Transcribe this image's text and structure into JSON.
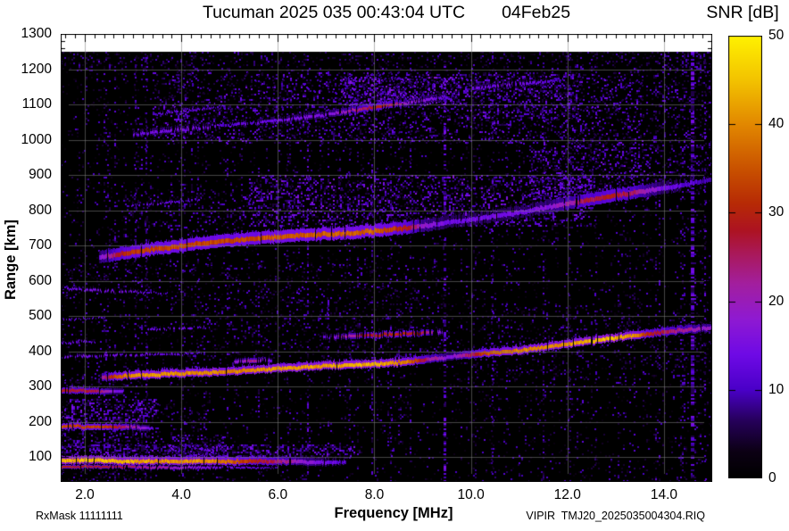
{
  "header": {
    "title": "Tucuman 2025 035 00:43:04 UTC",
    "date": "04Feb25"
  },
  "footer": {
    "left": "RxMask 11111111",
    "right": "VIPIR  TMJ20_2025035004304.RIQ"
  },
  "colorbar": {
    "title": "SNR [dB]",
    "min": 0,
    "max": 50,
    "tick_values": [
      0,
      10,
      20,
      30,
      40,
      50
    ],
    "tick_labels": [
      "0",
      "10",
      "20",
      "30",
      "40",
      "50"
    ]
  },
  "axes": {
    "xlabel": "Frequency [MHz]",
    "ylabel": "Range [km]",
    "x_tick_values": [
      2,
      4,
      6,
      8,
      10,
      12,
      14
    ],
    "x_tick_labels": [
      "2.0",
      "4.0",
      "6.0",
      "8.0",
      "10.0",
      "12.0",
      "14.0"
    ],
    "y_tick_values": [
      100,
      200,
      300,
      400,
      500,
      600,
      700,
      800,
      900,
      1000,
      1100,
      1200,
      1300
    ],
    "y_tick_labels": [
      "100",
      "200",
      "300",
      "400",
      "500",
      "600",
      "700",
      "800",
      "900",
      "1000",
      "1100",
      "1200",
      "1300"
    ]
  },
  "chart_data": {
    "type": "heatmap",
    "title": "Tucuman 2025 035 00:43:04 UTC",
    "date": "04Feb25",
    "station": "Tucuman",
    "xlabel": "Frequency [MHz]",
    "ylabel": "Range [km]",
    "zlabel": "SNR [dB]",
    "x_range_mhz": [
      1.5,
      15.0
    ],
    "y_range_km": [
      30,
      1300
    ],
    "z_range_db": [
      0,
      50
    ],
    "x_major_tick_step": 2.0,
    "x_minor_tick_step": 0.2,
    "y_major_tick_step": 100,
    "y_minor_tick_step": 20,
    "grid": true,
    "grid_color": "#808080",
    "background_color": "#000000",
    "no_data_color": "#ffffff",
    "data_max_range_km": 1250,
    "colormap_stops": [
      {
        "t": 0.0,
        "c": "#000000"
      },
      {
        "t": 0.06,
        "c": "#0c0014"
      },
      {
        "t": 0.13,
        "c": "#26005a"
      },
      {
        "t": 0.2,
        "c": "#4a00c8"
      },
      {
        "t": 0.28,
        "c": "#6f0ae6"
      },
      {
        "t": 0.36,
        "c": "#8f1ad2"
      },
      {
        "t": 0.44,
        "c": "#a31f9e"
      },
      {
        "t": 0.5,
        "c": "#a91a62"
      },
      {
        "t": 0.56,
        "c": "#ad1322"
      },
      {
        "t": 0.62,
        "c": "#b72a06"
      },
      {
        "t": 0.7,
        "c": "#c95200"
      },
      {
        "t": 0.8,
        "c": "#e28800"
      },
      {
        "t": 0.9,
        "c": "#f3c300"
      },
      {
        "t": 1.0,
        "c": "#fff200"
      }
    ],
    "traces": [
      {
        "name": "es-layer-1st-hop",
        "points": [
          [
            1.5,
            90
          ],
          [
            3.5,
            89
          ],
          [
            5.5,
            88
          ],
          [
            7.4,
            86
          ]
        ],
        "db": [
          [
            1.5,
            43
          ],
          [
            2.5,
            44
          ],
          [
            3.5,
            41
          ],
          [
            4.6,
            40
          ],
          [
            5.2,
            34
          ],
          [
            5.8,
            26
          ],
          [
            6.6,
            17
          ],
          [
            7.4,
            11
          ]
        ],
        "th": 4,
        "halo": 5,
        "gap": 0.02
      },
      {
        "name": "es-layer-1st-hop-lower",
        "points": [
          [
            1.5,
            73
          ],
          [
            4.0,
            71
          ],
          [
            6.0,
            70
          ]
        ],
        "db": [
          [
            1.5,
            30
          ],
          [
            2.5,
            27
          ],
          [
            3.5,
            22
          ],
          [
            4.8,
            14
          ],
          [
            6.0,
            8
          ]
        ],
        "th": 2,
        "halo": 2,
        "gap": 0.1
      },
      {
        "name": "es-layer-2nd-hop",
        "points": [
          [
            1.5,
            189
          ],
          [
            3.4,
            185
          ]
        ],
        "db": [
          [
            1.5,
            34
          ],
          [
            2.4,
            33
          ],
          [
            2.9,
            23
          ],
          [
            3.4,
            12
          ]
        ],
        "th": 3,
        "halo": 4,
        "gap": 0.05
      },
      {
        "name": "es-layer-3rd-hop",
        "points": [
          [
            1.5,
            291
          ],
          [
            2.8,
            287
          ]
        ],
        "db": [
          [
            1.5,
            30
          ],
          [
            2.2,
            27
          ],
          [
            2.8,
            12
          ]
        ],
        "th": 3,
        "halo": 4,
        "gap": 0.06
      },
      {
        "name": "f-layer-1st-hop",
        "points": [
          [
            2.35,
            326
          ],
          [
            3,
            332
          ],
          [
            4,
            337
          ],
          [
            4.6,
            340
          ],
          [
            5.5,
            347
          ],
          [
            6.5,
            355
          ],
          [
            7.5,
            361
          ],
          [
            8.35,
            366
          ],
          [
            9,
            375
          ],
          [
            9.6,
            385
          ],
          [
            10.1,
            392
          ],
          [
            10.8,
            400
          ],
          [
            11.3,
            407
          ],
          [
            12.2,
            425
          ],
          [
            13,
            438
          ],
          [
            13.4,
            445
          ],
          [
            14.2,
            458
          ],
          [
            15,
            467
          ]
        ],
        "db": [
          [
            2.35,
            20
          ],
          [
            2.6,
            34
          ],
          [
            3,
            41
          ],
          [
            4,
            40
          ],
          [
            5,
            39
          ],
          [
            6,
            41
          ],
          [
            7,
            42
          ],
          [
            8,
            43
          ],
          [
            8.7,
            38
          ],
          [
            9.1,
            23
          ],
          [
            9.6,
            16
          ],
          [
            10.1,
            29
          ],
          [
            10.5,
            37
          ],
          [
            11,
            39
          ],
          [
            12,
            41
          ],
          [
            12.9,
            45
          ],
          [
            13.4,
            40
          ],
          [
            13.7,
            29
          ],
          [
            14,
            26
          ],
          [
            14.4,
            22
          ],
          [
            15,
            18
          ]
        ],
        "th": 4,
        "halo": 5,
        "gap": 0.02
      },
      {
        "name": "f-layer-upper-branch",
        "points": [
          [
            6.9,
            441
          ],
          [
            8.0,
            448
          ],
          [
            9.4,
            456
          ]
        ],
        "db": [
          [
            6.9,
            13
          ],
          [
            7.6,
            24
          ],
          [
            8.3,
            31
          ],
          [
            8.9,
            28
          ],
          [
            9.4,
            15
          ]
        ],
        "th": 3,
        "halo": 4,
        "gap": 0.3
      },
      {
        "name": "f-layer-faint-low",
        "points": [
          [
            1.5,
            385
          ],
          [
            3.0,
            390
          ],
          [
            4.4,
            394
          ]
        ],
        "db": [
          [
            1.5,
            13
          ],
          [
            2.5,
            15
          ],
          [
            3.5,
            13
          ],
          [
            4.4,
            9
          ]
        ],
        "th": 2,
        "halo": 2,
        "gap": 0.4
      },
      {
        "name": "faint-dash-a",
        "points": [
          [
            1.5,
            424
          ],
          [
            2.2,
            428
          ]
        ],
        "db": [
          [
            1.5,
            13
          ],
          [
            2.2,
            11
          ]
        ],
        "th": 2,
        "halo": 2,
        "gap": 0.35
      },
      {
        "name": "faint-dash-b",
        "points": [
          [
            5.1,
            372
          ],
          [
            5.9,
            377
          ]
        ],
        "db": [
          [
            5.1,
            18
          ],
          [
            5.5,
            23
          ],
          [
            5.9,
            13
          ]
        ],
        "th": 3,
        "halo": 3,
        "gap": 0.2
      },
      {
        "name": "faint-dash-c",
        "points": [
          [
            3.3,
            462
          ],
          [
            4.6,
            468
          ]
        ],
        "db": [
          [
            3.3,
            12
          ],
          [
            4.0,
            14
          ],
          [
            4.6,
            10
          ]
        ],
        "th": 2,
        "halo": 2,
        "gap": 0.4
      },
      {
        "name": "faint-dash-d",
        "points": [
          [
            1.6,
            578
          ],
          [
            2.6,
            570
          ],
          [
            3.7,
            564
          ]
        ],
        "db": [
          [
            1.6,
            12
          ],
          [
            2.2,
            16
          ],
          [
            3.0,
            14
          ],
          [
            3.7,
            9
          ]
        ],
        "th": 2,
        "halo": 2,
        "gap": 0.45
      },
      {
        "name": "faint-dash-e",
        "points": [
          [
            1.5,
            490
          ],
          [
            2.4,
            495
          ]
        ],
        "db": [
          [
            1.5,
            13
          ],
          [
            2.4,
            10
          ]
        ],
        "th": 2,
        "halo": 2,
        "gap": 0.4
      },
      {
        "name": "f-layer-2nd-hop",
        "points": [
          [
            2.3,
            668
          ],
          [
            3.5,
            692
          ],
          [
            5,
            716
          ],
          [
            6.5,
            730
          ],
          [
            7.6,
            737
          ],
          [
            8.6,
            750
          ],
          [
            9.2,
            760
          ],
          [
            10,
            775
          ],
          [
            11,
            795
          ],
          [
            12,
            820
          ],
          [
            13,
            843
          ],
          [
            13.6,
            856
          ],
          [
            14.2,
            868
          ],
          [
            15,
            888
          ]
        ],
        "db": [
          [
            2.3,
            16
          ],
          [
            2.8,
            30
          ],
          [
            3.5,
            34
          ],
          [
            5,
            33
          ],
          [
            6,
            35
          ],
          [
            7,
            36
          ],
          [
            8,
            36
          ],
          [
            8.6,
            30
          ],
          [
            9,
            18
          ],
          [
            9.6,
            13
          ],
          [
            10.5,
            15
          ],
          [
            11.3,
            14
          ],
          [
            11.9,
            20
          ],
          [
            12.4,
            26
          ],
          [
            12.9,
            28
          ],
          [
            13.4,
            24
          ],
          [
            14,
            14
          ],
          [
            14.6,
            11
          ],
          [
            15,
            9
          ]
        ],
        "th": 5,
        "halo": 9,
        "gap": 0.03
      },
      {
        "name": "f-layer-2nd-hop-upper",
        "points": [
          [
            2.9,
            812
          ],
          [
            4.4,
            831
          ]
        ],
        "db": [
          [
            2.9,
            11
          ],
          [
            3.6,
            13
          ],
          [
            4.4,
            10
          ]
        ],
        "th": 2,
        "halo": 3,
        "gap": 0.35
      },
      {
        "name": "f-layer-3rd-hop",
        "points": [
          [
            3.0,
            1016
          ],
          [
            4.0,
            1030
          ],
          [
            4.8,
            1041
          ],
          [
            6.0,
            1056
          ],
          [
            7.0,
            1072
          ],
          [
            7.9,
            1092
          ],
          [
            8.6,
            1104
          ],
          [
            9.5,
            1124
          ]
        ],
        "db": [
          [
            3.0,
            13
          ],
          [
            4.0,
            15
          ],
          [
            5.0,
            12
          ],
          [
            6.0,
            14
          ],
          [
            7.0,
            15
          ],
          [
            7.8,
            26
          ],
          [
            8.2,
            30
          ],
          [
            8.6,
            20
          ],
          [
            9.2,
            15
          ],
          [
            9.5,
            12
          ]
        ],
        "th": 3,
        "halo": 5,
        "gap": 0.25
      },
      {
        "name": "f-layer-3rd-hop-upper",
        "points": [
          [
            3.4,
            1072
          ],
          [
            4.9,
            1095
          ]
        ],
        "db": [
          [
            3.4,
            11
          ],
          [
            4.2,
            13
          ],
          [
            4.9,
            10
          ]
        ],
        "th": 2,
        "halo": 3,
        "gap": 0.35
      },
      {
        "name": "f-layer-3rd-hop-high",
        "points": [
          [
            10.1,
            1148
          ],
          [
            11.0,
            1160
          ],
          [
            11.9,
            1170
          ]
        ],
        "db": [
          [
            10.1,
            13
          ],
          [
            10.8,
            15
          ],
          [
            11.9,
            10
          ]
        ],
        "th": 3,
        "halo": 4,
        "gap": 0.35
      }
    ],
    "noise_regions": [
      [
        1.5,
        3.6,
        120,
        185,
        0.2,
        4,
        14
      ],
      [
        1.5,
        3.5,
        200,
        265,
        0.38,
        4,
        17
      ],
      [
        3.5,
        4.6,
        200,
        250,
        0.15,
        3,
        12
      ],
      [
        1.5,
        3.2,
        300,
        335,
        0.16,
        3,
        12
      ],
      [
        1.5,
        7.6,
        95,
        135,
        0.42,
        4,
        16
      ],
      [
        3.7,
        4.9,
        100,
        165,
        0.3,
        4,
        14
      ],
      [
        1.5,
        3.5,
        30,
        80,
        0.12,
        3,
        10
      ],
      [
        1.5,
        9.5,
        545,
        650,
        0.09,
        3,
        12
      ],
      [
        5.4,
        12.6,
        755,
        900,
        0.28,
        4,
        17
      ],
      [
        2.8,
        5.4,
        740,
        855,
        0.15,
        3,
        13
      ],
      [
        3.4,
        13.6,
        990,
        1190,
        0.2,
        4,
        15
      ],
      [
        7.3,
        9.7,
        1100,
        1178,
        0.38,
        5,
        18
      ],
      [
        9.7,
        12.2,
        1060,
        1190,
        0.22,
        4,
        15
      ],
      [
        1.5,
        15.0,
        1195,
        1250,
        0.1,
        3,
        10
      ],
      [
        11.2,
        13.7,
        830,
        990,
        0.28,
        4,
        15
      ],
      [
        13.7,
        15.0,
        850,
        1250,
        0.15,
        4,
        13
      ],
      [
        9.6,
        15.0,
        300,
        530,
        0.07,
        3,
        11
      ],
      [
        4.2,
        9.6,
        380,
        545,
        0.08,
        3,
        11
      ]
    ],
    "rfi_stripes": [
      [
        2.62,
        0.25,
        2,
        3,
        13
      ],
      [
        3.05,
        0.3,
        2,
        3,
        13
      ],
      [
        3.28,
        0.25,
        2,
        3,
        13
      ],
      [
        3.8,
        0.15,
        2,
        3,
        12
      ],
      [
        4.35,
        0.15,
        2,
        3,
        12
      ],
      [
        4.95,
        0.2,
        2,
        3,
        13
      ],
      [
        5.6,
        0.25,
        2,
        3,
        13
      ],
      [
        6.2,
        0.15,
        2,
        3,
        12
      ],
      [
        6.62,
        0.3,
        2,
        4,
        14
      ],
      [
        7.05,
        0.2,
        2,
        3,
        13
      ],
      [
        7.5,
        0.25,
        2,
        3,
        13
      ],
      [
        7.95,
        0.3,
        2,
        4,
        14
      ],
      [
        8.35,
        0.2,
        2,
        3,
        12
      ],
      [
        8.75,
        0.2,
        2,
        3,
        12
      ],
      [
        9.45,
        0.5,
        3,
        5,
        16
      ],
      [
        10.1,
        0.15,
        2,
        3,
        12
      ],
      [
        10.45,
        0.25,
        2,
        3,
        13
      ],
      [
        10.75,
        0.2,
        2,
        3,
        12
      ],
      [
        11.0,
        0.2,
        2,
        3,
        12
      ],
      [
        11.5,
        0.25,
        2,
        3,
        13
      ],
      [
        12.05,
        0.15,
        2,
        3,
        12
      ],
      [
        12.6,
        0.15,
        2,
        3,
        12
      ],
      [
        13.3,
        0.2,
        2,
        3,
        12
      ],
      [
        13.9,
        0.2,
        2,
        3,
        13
      ],
      [
        14.6,
        0.55,
        4,
        5,
        16
      ],
      [
        14.85,
        0.3,
        2,
        4,
        14
      ]
    ],
    "base_noise": {
      "density": 0.055,
      "db_min": 2,
      "db_max": 11
    }
  }
}
